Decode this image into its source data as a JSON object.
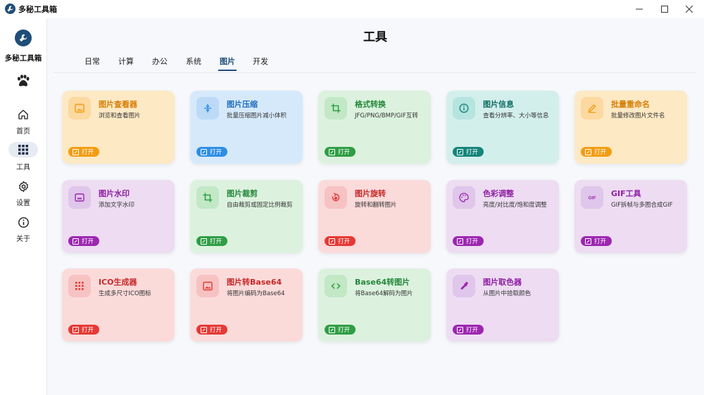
{
  "window": {
    "title": "多秘工具箱",
    "minimize_glyph": "—",
    "maximize_glyph": "☐",
    "close_glyph": "✕"
  },
  "sidebar": {
    "brand_name": "多秘工具箱",
    "items": [
      {
        "label": "首页",
        "icon": "home-icon"
      },
      {
        "label": "工具",
        "icon": "grid-icon",
        "active": true
      },
      {
        "label": "设置",
        "icon": "gear-icon"
      },
      {
        "label": "关于",
        "icon": "info-icon"
      }
    ]
  },
  "header": {
    "title": "工具"
  },
  "tabs": [
    {
      "label": "日常"
    },
    {
      "label": "计算"
    },
    {
      "label": "办公"
    },
    {
      "label": "系统"
    },
    {
      "label": "图片",
      "active": true
    },
    {
      "label": "开发"
    }
  ],
  "open_label": "打开",
  "cards": [
    {
      "title": "图片查看器",
      "desc": "浏览和查看图片",
      "icon": "image-icon",
      "theme": {
        "bg": "#fde9c4",
        "accent": "#f39c12",
        "title": "#d87e06",
        "iconbg": "#fbd9a0"
      }
    },
    {
      "title": "图片压缩",
      "desc": "批量压缩图片减小体积",
      "icon": "compress-icon",
      "theme": {
        "bg": "#d6e9fb",
        "accent": "#2e8ee6",
        "title": "#1f6fc0",
        "iconbg": "#bcdaf7"
      }
    },
    {
      "title": "格式转换",
      "desc": "JFG/PNG/BMP/GIF互转",
      "icon": "crop-icon",
      "theme": {
        "bg": "#dcf2de",
        "accent": "#2f9e45",
        "title": "#24873a",
        "iconbg": "#c2e8c6"
      }
    },
    {
      "title": "图片信息",
      "desc": "查看分辨率、大小等信息",
      "icon": "info-icon",
      "theme": {
        "bg": "#d3efec",
        "accent": "#14857a",
        "title": "#0f6d64",
        "iconbg": "#b6e4de"
      }
    },
    {
      "title": "批量重命名",
      "desc": "批量修改图片文件名",
      "icon": "edit-icon",
      "theme": {
        "bg": "#fde9c4",
        "accent": "#f39c12",
        "title": "#d87e06",
        "iconbg": "#fbd9a0"
      }
    },
    {
      "title": "图片水印",
      "desc": "添加文字水印",
      "icon": "watermark-icon",
      "theme": {
        "bg": "#eddcf2",
        "accent": "#9c27b0",
        "title": "#8e1fa3",
        "iconbg": "#e0c6ea"
      }
    },
    {
      "title": "图片裁剪",
      "desc": "自由裁剪或固定比例裁剪",
      "icon": "crop-icon",
      "theme": {
        "bg": "#dcf2de",
        "accent": "#2f9e45",
        "title": "#24873a",
        "iconbg": "#c2e8c6"
      }
    },
    {
      "title": "图片旋转",
      "desc": "旋转和翻转图片",
      "icon": "rotate-icon",
      "theme": {
        "bg": "#fbdada",
        "accent": "#e53935",
        "title": "#c62828",
        "iconbg": "#f7c2c2"
      }
    },
    {
      "title": "色彩调整",
      "desc": "亮度/对比度/饱和度调整",
      "icon": "palette-icon",
      "theme": {
        "bg": "#eddcf2",
        "accent": "#9c27b0",
        "title": "#8e1fa3",
        "iconbg": "#e0c6ea"
      }
    },
    {
      "title": "GIF工具",
      "desc": "GIF拆帧与多图合成GIF",
      "icon": "gif-icon",
      "theme": {
        "bg": "#eddcf2",
        "accent": "#9c27b0",
        "title": "#8e1fa3",
        "iconbg": "#e0c6ea"
      }
    },
    {
      "title": "ICO生成器",
      "desc": "生成多尺寸ICO图标",
      "icon": "dots-icon",
      "theme": {
        "bg": "#fbdada",
        "accent": "#e53935",
        "title": "#c62828",
        "iconbg": "#f7c2c2"
      }
    },
    {
      "title": "图片转Base64",
      "desc": "将图片编码为Base64",
      "icon": "image-icon",
      "theme": {
        "bg": "#fbdada",
        "accent": "#e53935",
        "title": "#c62828",
        "iconbg": "#f7c2c2"
      }
    },
    {
      "title": "Base64转图片",
      "desc": "将Base64解码为图片",
      "icon": "code-icon",
      "theme": {
        "bg": "#dcf2de",
        "accent": "#2f9e45",
        "title": "#24873a",
        "iconbg": "#c2e8c6"
      }
    },
    {
      "title": "图片取色器",
      "desc": "从图片中拾取颜色",
      "icon": "eyedropper-icon",
      "theme": {
        "bg": "#eddcf2",
        "accent": "#9c27b0",
        "title": "#8e1fa3",
        "iconbg": "#e0c6ea"
      }
    }
  ]
}
